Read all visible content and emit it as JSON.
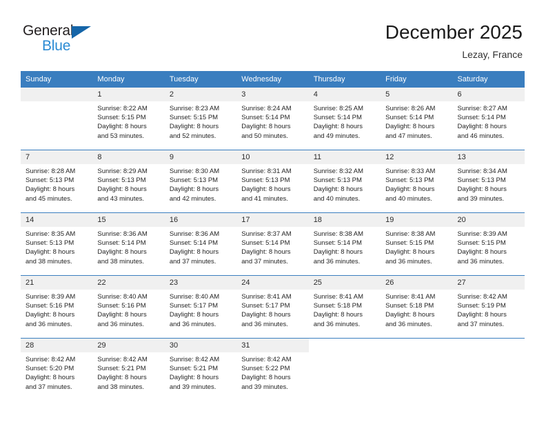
{
  "brand": {
    "name_top": "General",
    "name_bottom": "Blue",
    "accent_color": "#2b8bd4",
    "triangle_color": "#1565a8"
  },
  "header": {
    "title": "December 2025",
    "subtitle": "Lezay, France"
  },
  "calendar": {
    "header_bg": "#3a7ebf",
    "daynum_bg": "#f0f0f0",
    "weekday_headers": [
      "Sunday",
      "Monday",
      "Tuesday",
      "Wednesday",
      "Thursday",
      "Friday",
      "Saturday"
    ],
    "weeks": [
      [
        {
          "day": "",
          "blank": true,
          "shaded": true,
          "lines": []
        },
        {
          "day": "1",
          "lines": [
            "Sunrise: 8:22 AM",
            "Sunset: 5:15 PM",
            "Daylight: 8 hours",
            "and 53 minutes."
          ]
        },
        {
          "day": "2",
          "lines": [
            "Sunrise: 8:23 AM",
            "Sunset: 5:15 PM",
            "Daylight: 8 hours",
            "and 52 minutes."
          ]
        },
        {
          "day": "3",
          "lines": [
            "Sunrise: 8:24 AM",
            "Sunset: 5:14 PM",
            "Daylight: 8 hours",
            "and 50 minutes."
          ]
        },
        {
          "day": "4",
          "lines": [
            "Sunrise: 8:25 AM",
            "Sunset: 5:14 PM",
            "Daylight: 8 hours",
            "and 49 minutes."
          ]
        },
        {
          "day": "5",
          "lines": [
            "Sunrise: 8:26 AM",
            "Sunset: 5:14 PM",
            "Daylight: 8 hours",
            "and 47 minutes."
          ]
        },
        {
          "day": "6",
          "lines": [
            "Sunrise: 8:27 AM",
            "Sunset: 5:14 PM",
            "Daylight: 8 hours",
            "and 46 minutes."
          ]
        }
      ],
      [
        {
          "day": "7",
          "lines": [
            "Sunrise: 8:28 AM",
            "Sunset: 5:13 PM",
            "Daylight: 8 hours",
            "and 45 minutes."
          ]
        },
        {
          "day": "8",
          "lines": [
            "Sunrise: 8:29 AM",
            "Sunset: 5:13 PM",
            "Daylight: 8 hours",
            "and 43 minutes."
          ]
        },
        {
          "day": "9",
          "lines": [
            "Sunrise: 8:30 AM",
            "Sunset: 5:13 PM",
            "Daylight: 8 hours",
            "and 42 minutes."
          ]
        },
        {
          "day": "10",
          "lines": [
            "Sunrise: 8:31 AM",
            "Sunset: 5:13 PM",
            "Daylight: 8 hours",
            "and 41 minutes."
          ]
        },
        {
          "day": "11",
          "lines": [
            "Sunrise: 8:32 AM",
            "Sunset: 5:13 PM",
            "Daylight: 8 hours",
            "and 40 minutes."
          ]
        },
        {
          "day": "12",
          "lines": [
            "Sunrise: 8:33 AM",
            "Sunset: 5:13 PM",
            "Daylight: 8 hours",
            "and 40 minutes."
          ]
        },
        {
          "day": "13",
          "lines": [
            "Sunrise: 8:34 AM",
            "Sunset: 5:13 PM",
            "Daylight: 8 hours",
            "and 39 minutes."
          ]
        }
      ],
      [
        {
          "day": "14",
          "lines": [
            "Sunrise: 8:35 AM",
            "Sunset: 5:13 PM",
            "Daylight: 8 hours",
            "and 38 minutes."
          ]
        },
        {
          "day": "15",
          "lines": [
            "Sunrise: 8:36 AM",
            "Sunset: 5:14 PM",
            "Daylight: 8 hours",
            "and 38 minutes."
          ]
        },
        {
          "day": "16",
          "lines": [
            "Sunrise: 8:36 AM",
            "Sunset: 5:14 PM",
            "Daylight: 8 hours",
            "and 37 minutes."
          ]
        },
        {
          "day": "17",
          "lines": [
            "Sunrise: 8:37 AM",
            "Sunset: 5:14 PM",
            "Daylight: 8 hours",
            "and 37 minutes."
          ]
        },
        {
          "day": "18",
          "lines": [
            "Sunrise: 8:38 AM",
            "Sunset: 5:14 PM",
            "Daylight: 8 hours",
            "and 36 minutes."
          ]
        },
        {
          "day": "19",
          "lines": [
            "Sunrise: 8:38 AM",
            "Sunset: 5:15 PM",
            "Daylight: 8 hours",
            "and 36 minutes."
          ]
        },
        {
          "day": "20",
          "lines": [
            "Sunrise: 8:39 AM",
            "Sunset: 5:15 PM",
            "Daylight: 8 hours",
            "and 36 minutes."
          ]
        }
      ],
      [
        {
          "day": "21",
          "lines": [
            "Sunrise: 8:39 AM",
            "Sunset: 5:16 PM",
            "Daylight: 8 hours",
            "and 36 minutes."
          ]
        },
        {
          "day": "22",
          "lines": [
            "Sunrise: 8:40 AM",
            "Sunset: 5:16 PM",
            "Daylight: 8 hours",
            "and 36 minutes."
          ]
        },
        {
          "day": "23",
          "lines": [
            "Sunrise: 8:40 AM",
            "Sunset: 5:17 PM",
            "Daylight: 8 hours",
            "and 36 minutes."
          ]
        },
        {
          "day": "24",
          "lines": [
            "Sunrise: 8:41 AM",
            "Sunset: 5:17 PM",
            "Daylight: 8 hours",
            "and 36 minutes."
          ]
        },
        {
          "day": "25",
          "lines": [
            "Sunrise: 8:41 AM",
            "Sunset: 5:18 PM",
            "Daylight: 8 hours",
            "and 36 minutes."
          ]
        },
        {
          "day": "26",
          "lines": [
            "Sunrise: 8:41 AM",
            "Sunset: 5:18 PM",
            "Daylight: 8 hours",
            "and 36 minutes."
          ]
        },
        {
          "day": "27",
          "lines": [
            "Sunrise: 8:42 AM",
            "Sunset: 5:19 PM",
            "Daylight: 8 hours",
            "and 37 minutes."
          ]
        }
      ],
      [
        {
          "day": "28",
          "lines": [
            "Sunrise: 8:42 AM",
            "Sunset: 5:20 PM",
            "Daylight: 8 hours",
            "and 37 minutes."
          ]
        },
        {
          "day": "29",
          "lines": [
            "Sunrise: 8:42 AM",
            "Sunset: 5:21 PM",
            "Daylight: 8 hours",
            "and 38 minutes."
          ]
        },
        {
          "day": "30",
          "lines": [
            "Sunrise: 8:42 AM",
            "Sunset: 5:21 PM",
            "Daylight: 8 hours",
            "and 39 minutes."
          ]
        },
        {
          "day": "31",
          "lines": [
            "Sunrise: 8:42 AM",
            "Sunset: 5:22 PM",
            "Daylight: 8 hours",
            "and 39 minutes."
          ]
        },
        {
          "day": "",
          "blank": true,
          "lines": []
        },
        {
          "day": "",
          "blank": true,
          "lines": []
        },
        {
          "day": "",
          "blank": true,
          "lines": []
        }
      ]
    ]
  }
}
